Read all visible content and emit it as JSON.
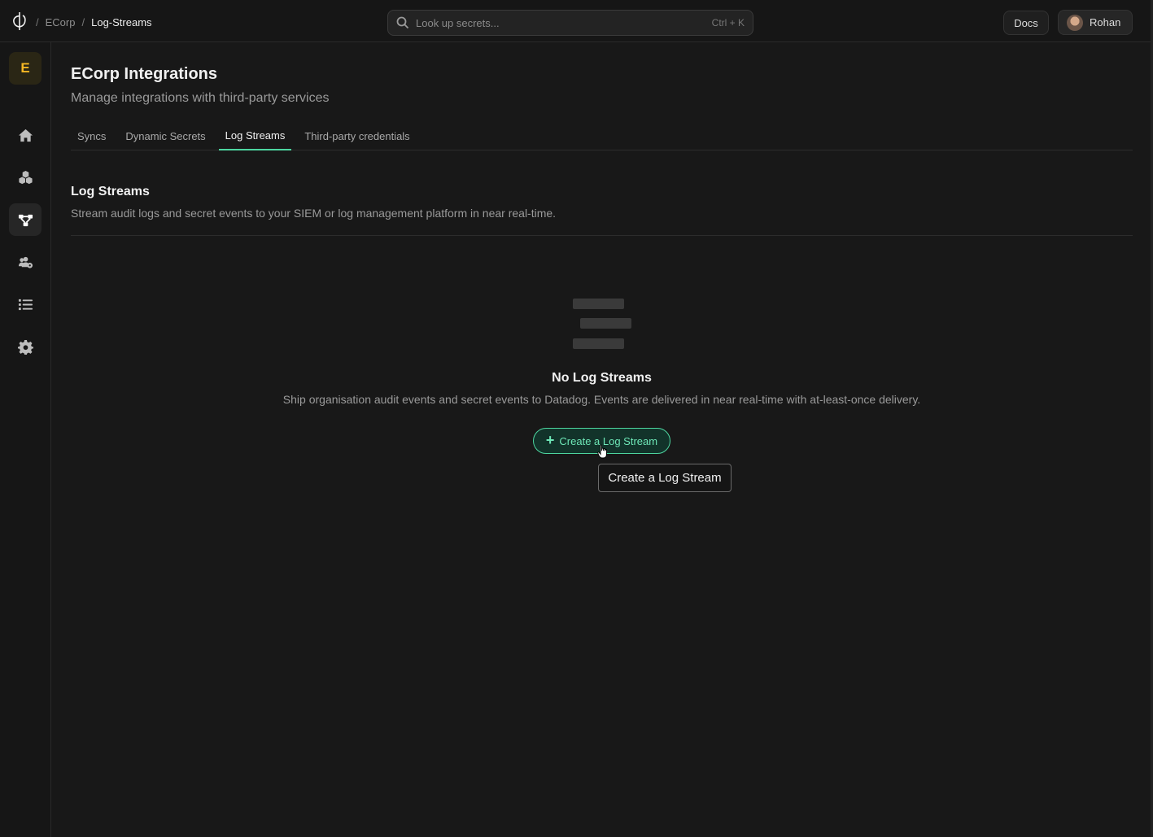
{
  "breadcrumb": {
    "separator": "/",
    "org": "ECorp",
    "page": "Log-Streams"
  },
  "search": {
    "placeholder": "Look up secrets...",
    "shortcut": "Ctrl + K"
  },
  "header": {
    "docs_label": "Docs",
    "user_name": "Rohan"
  },
  "sidebar": {
    "org_initial": "E",
    "items": [
      {
        "name": "home",
        "icon": "home-icon"
      },
      {
        "name": "apps",
        "icon": "cubes-icon"
      },
      {
        "name": "integrations",
        "icon": "network-icon",
        "active": true
      },
      {
        "name": "members",
        "icon": "users-gear-icon"
      },
      {
        "name": "logs",
        "icon": "list-icon"
      },
      {
        "name": "settings",
        "icon": "gear-icon"
      }
    ]
  },
  "page": {
    "title": "ECorp Integrations",
    "subtitle": "Manage integrations with third-party services"
  },
  "tabs": [
    {
      "label": "Syncs",
      "active": false
    },
    {
      "label": "Dynamic Secrets",
      "active": false
    },
    {
      "label": "Log Streams",
      "active": true
    },
    {
      "label": "Third-party credentials",
      "active": false
    }
  ],
  "section": {
    "title": "Log Streams",
    "description": "Stream audit logs and secret events to your SIEM or log management platform in near real-time."
  },
  "empty_state": {
    "title": "No Log Streams",
    "description": "Ship organisation audit events and secret events to Datadog. Events are delivered in near real-time with at-least-once delivery.",
    "button_label": "Create a Log Stream",
    "tooltip": "Create a Log Stream"
  },
  "colors": {
    "accent": "#4dd6a0",
    "org_badge": "#f5b724",
    "background": "#181818"
  }
}
